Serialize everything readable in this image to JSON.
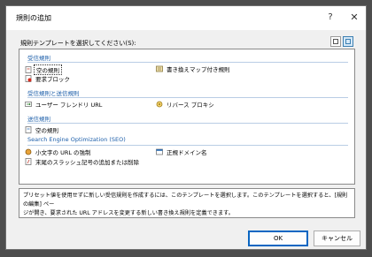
{
  "dialog": {
    "title": "規則の追加",
    "help_glyph": "?",
    "close_glyph": "✕"
  },
  "select_label": "規則テンプレートを選択してください(S):",
  "view_toggle": {
    "icons": [
      "large-icons-view-icon",
      "list-view-icon"
    ],
    "active": "list-view-icon"
  },
  "groups": [
    {
      "title": "受信規則",
      "items": [
        {
          "label": "空の規則",
          "icon": "blank-rule-icon",
          "selected": true
        },
        {
          "label": "要求ブロック",
          "icon": "block-request-icon",
          "selected": false
        },
        {
          "label": "書き換えマップ付き規則",
          "icon": "rewrite-map-rule-icon",
          "selected": false
        }
      ]
    },
    {
      "title": "受信規則と送信規則",
      "items": [
        {
          "label": "ユーザー フレンドリ URL",
          "icon": "user-friendly-url-icon",
          "selected": false
        },
        {
          "label": "リバース プロキシ",
          "icon": "reverse-proxy-icon",
          "selected": false
        }
      ]
    },
    {
      "title": "送信規則",
      "items": [
        {
          "label": "空の規則",
          "icon": "blank-outbound-rule-icon",
          "selected": false
        }
      ]
    },
    {
      "title": "Search Engine Optimization (SEO)",
      "items": [
        {
          "label": "小文字の URL の強制",
          "icon": "lowercase-url-icon",
          "selected": false
        },
        {
          "label": "末尾のスラッシュ記号の追加または削除",
          "icon": "trailing-slash-icon",
          "selected": false
        },
        {
          "label": "正規ドメイン名",
          "icon": "canonical-domain-icon",
          "selected": false
        }
      ]
    }
  ],
  "description": {
    "line1": "プリセット値を使用せずに新しい受信規則を作成するには、このテンプレートを選択します。このテンプレートを選択すると、[規則の編集] ペー",
    "line2": "ジが開き、要求された URL アドレスを変更する新しい書き換え規則を定義できます。"
  },
  "buttons": {
    "ok": "OK",
    "cancel": "キャンセル"
  },
  "colors": {
    "accent": "#0a66c2",
    "group_title": "#1d5faa",
    "separator": "#b9cde5"
  }
}
